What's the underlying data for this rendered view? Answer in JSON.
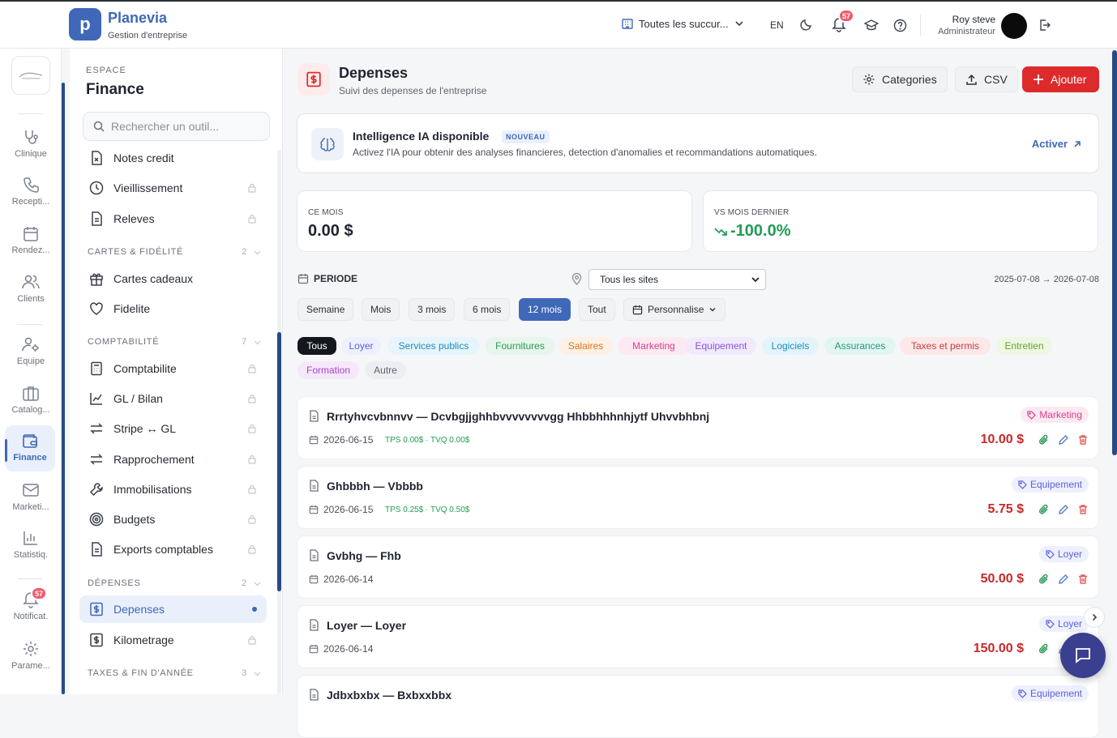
{
  "app": {
    "name": "Planevia",
    "subtitle": "Gestion d'entreprise",
    "logo_letter": "p"
  },
  "topbar": {
    "branch": "Toutes les succur...",
    "lang": "EN",
    "notif_count": "57",
    "user_name": "Roy steve",
    "user_role": "Administrateur"
  },
  "rail": {
    "items": [
      {
        "label": "Clinique",
        "icon": "stethoscope-icon"
      },
      {
        "label": "Recepti...",
        "icon": "phone-icon"
      },
      {
        "label": "Rendez...",
        "icon": "calendar-icon"
      },
      {
        "label": "Clients",
        "icon": "users-icon"
      },
      {
        "label": "Equipe",
        "icon": "user-gear-icon"
      },
      {
        "label": "Catalog...",
        "icon": "briefcase-icon"
      },
      {
        "label": "Finance",
        "icon": "wallet-icon"
      },
      {
        "label": "Marketi...",
        "icon": "mail-icon"
      },
      {
        "label": "Statistiq.",
        "icon": "bar-chart-icon"
      },
      {
        "label": "Notificat.",
        "icon": "bell-icon"
      },
      {
        "label": "Parame...",
        "icon": "gear-icon"
      }
    ],
    "notif_count": "57"
  },
  "sidepanel": {
    "space_label": "ESPACE",
    "title": "Finance",
    "search_placeholder": "Rechercher un outil...",
    "items": [
      {
        "label": "Notes credit"
      },
      {
        "label": "Vieillissement"
      },
      {
        "label": "Releves"
      },
      {
        "label": "Cartes cadeaux"
      },
      {
        "label": "Fidelite"
      },
      {
        "label": "Comptabilite"
      },
      {
        "label": "GL / Bilan"
      },
      {
        "label": "Stripe ↔ GL"
      },
      {
        "label": "Rapprochement"
      },
      {
        "label": "Immobilisations"
      },
      {
        "label": "Budgets"
      },
      {
        "label": "Exports comptables"
      },
      {
        "label": "Depenses"
      },
      {
        "label": "Kilometrage"
      }
    ],
    "sections": [
      {
        "label": "CARTES & FIDÉLITÉ",
        "count": "2"
      },
      {
        "label": "COMPTABILITÉ",
        "count": "7"
      },
      {
        "label": "DÉPENSES",
        "count": "2"
      },
      {
        "label": "TAXES & FIN D'ANNÉE",
        "count": "3"
      }
    ]
  },
  "header": {
    "title": "Depenses",
    "subtitle": "Suivi des depenses de l'entreprise",
    "btn_categories": "Categories",
    "btn_csv": "CSV",
    "btn_add": "Ajouter"
  },
  "ai": {
    "title": "Intelligence IA disponible",
    "badge": "NOUVEAU",
    "desc": "Activez l'IA pour obtenir des analyses financieres, detection d'anomalies et recommandations automatiques.",
    "action": "Activer"
  },
  "stats": [
    {
      "label": "CE MOIS",
      "value": "0.00 $"
    },
    {
      "label": "VS MOIS DERNIER",
      "value": "-100.0%"
    }
  ],
  "period": {
    "label": "PERIODE",
    "site": "Tous les sites",
    "range": "2025-07-08 → 2026-07-08",
    "buttons": [
      "Semaine",
      "Mois",
      "3 mois",
      "6 mois",
      "12 mois",
      "Tout",
      "Personnalise"
    ],
    "active": "12 mois"
  },
  "categories": [
    {
      "label": "Tous",
      "bg": "#14171c",
      "fg": "#ffffff"
    },
    {
      "label": "Loyer",
      "bg": "#eef0ff",
      "fg": "#5a62d6"
    },
    {
      "label": "Services publics",
      "bg": "#e6f5fb",
      "fg": "#1f8bb8"
    },
    {
      "label": "Fournitures",
      "bg": "#e6f6ec",
      "fg": "#2a9a58"
    },
    {
      "label": "Salaires",
      "bg": "#fdf0e4",
      "fg": "#d9761f"
    },
    {
      "label": "Marketing",
      "bg": "#fde9f2",
      "fg": "#d6408a"
    },
    {
      "label": "Equipement",
      "bg": "#f1eafd",
      "fg": "#8a52d6"
    },
    {
      "label": "Logiciels",
      "bg": "#e4f4fb",
      "fg": "#1a8fbf"
    },
    {
      "label": "Assurances",
      "bg": "#e2f5f1",
      "fg": "#1d9a80"
    },
    {
      "label": "Taxes et permis",
      "bg": "#fde8e8",
      "fg": "#c43c3c"
    },
    {
      "label": "Entretien",
      "bg": "#eef7e2",
      "fg": "#6aa22a"
    },
    {
      "label": "Formation",
      "bg": "#f6e8fb",
      "fg": "#a847c4"
    },
    {
      "label": "Autre",
      "bg": "#eceef1",
      "fg": "#5f6570"
    }
  ],
  "expenses": [
    {
      "title": "Rrrtyhvcvbnnvv — Dcvbgjjghhbvvvvvvvvgg Hhbbhhhnhjytf Uhvvbhbnj",
      "date": "2026-06-15",
      "tax": "TPS 0.00$ · TVQ 0.00$",
      "tag": "Marketing",
      "tag_bg": "#fde9f2",
      "tag_fg": "#d6408a",
      "amount": "10.00 $"
    },
    {
      "title": "Ghbbbh — Vbbbb",
      "date": "2026-06-15",
      "tax": "TPS 0.25$ · TVQ 0.50$",
      "tag": "Equipement",
      "tag_bg": "#eef0ff",
      "tag_fg": "#5a62d6",
      "amount": "5.75 $"
    },
    {
      "title": "Gvbhg — Fhb",
      "date": "2026-06-14",
      "tax": "",
      "tag": "Loyer",
      "tag_bg": "#eef0ff",
      "tag_fg": "#5a62d6",
      "amount": "50.00 $"
    },
    {
      "title": "Loyer — Loyer",
      "date": "2026-06-14",
      "tax": "",
      "tag": "Loyer",
      "tag_bg": "#eef0ff",
      "tag_fg": "#5a62d6",
      "amount": "150.00 $"
    },
    {
      "title": "Jdbxbxbx — Bxbxxbbx",
      "date": "",
      "tax": "",
      "tag": "Equipement",
      "tag_bg": "#eef0ff",
      "tag_fg": "#5a62d6",
      "amount": ""
    }
  ]
}
